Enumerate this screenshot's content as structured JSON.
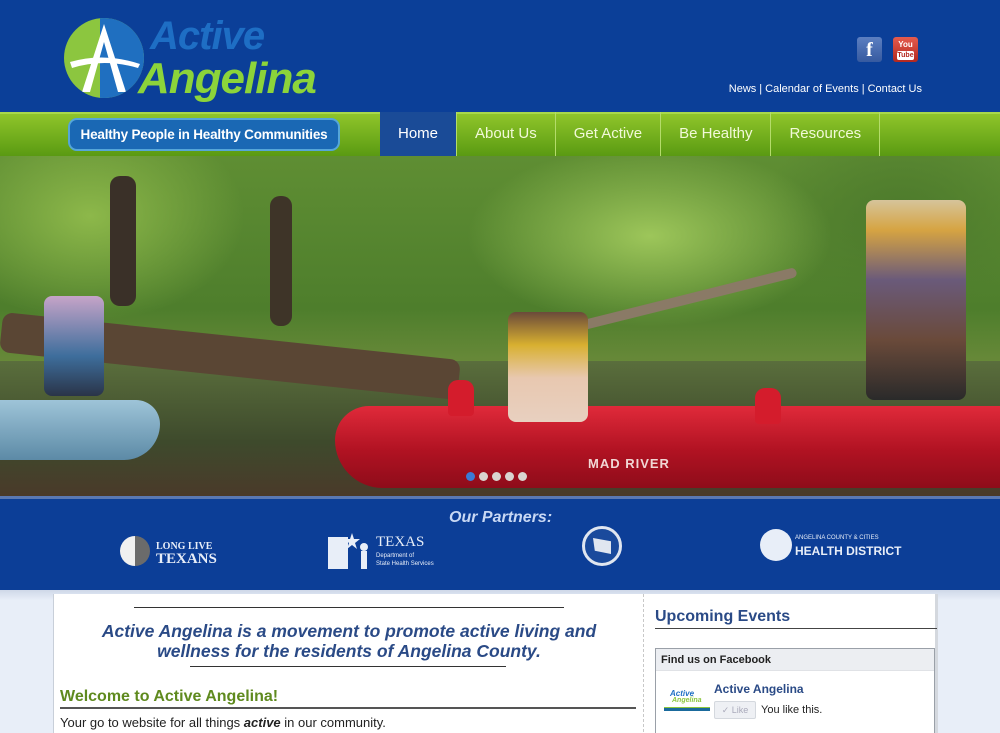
{
  "header": {
    "logo": {
      "line1": "Active",
      "line2": "Angelina"
    },
    "social": [
      {
        "name": "facebook",
        "glyph": "f"
      },
      {
        "name": "youtube",
        "glyph_top": "You",
        "glyph_bottom": "Tube"
      }
    ],
    "top_links": [
      "News",
      "Calendar of Events",
      "Contact Us"
    ],
    "separator": "|"
  },
  "nav": {
    "tagline": "Healthy People in Healthy Communities",
    "items": [
      {
        "label": "Home",
        "active": true
      },
      {
        "label": "About Us",
        "active": false
      },
      {
        "label": "Get Active",
        "active": false
      },
      {
        "label": "Be Healthy",
        "active": false
      },
      {
        "label": "Resources",
        "active": false
      }
    ]
  },
  "hero": {
    "kayak_brand": "MAD RIVER",
    "slides_total": 5,
    "active_slide": 1
  },
  "partners": {
    "title": "Our Partners:",
    "items": [
      {
        "line1": "LONG LIVE",
        "line2": "TEXANS"
      },
      {
        "line1": "TEXAS",
        "line2": "Department of",
        "line3": "State Health Services"
      },
      {
        "line1": ""
      },
      {
        "line1": "ANGELINA COUNTY & CITIES",
        "line2": "HEALTH DISTRICT"
      }
    ]
  },
  "main": {
    "mission": "Active Angelina is a movement to promote active living and wellness for the residents of Angelina County.",
    "welcome_heading": "Welcome to Active Angelina!",
    "body_before": "Your go to website for all things ",
    "body_emphasis": "active",
    "body_after": " in our community."
  },
  "sidebar": {
    "title": "Upcoming Events",
    "facebook_widget": {
      "header": "Find us on Facebook",
      "page_name": "Active Angelina",
      "like_label": "✓ Like",
      "status": "You like this.",
      "logo_line1": "Active",
      "logo_line2": "Angelina"
    }
  },
  "colors": {
    "header_blue": "#0b3f98",
    "nav_green": "#7ab51d",
    "nav_active": "#1a4b97",
    "brand_blue": "#1e6ec4",
    "brand_green": "#8cd43a",
    "heading_green": "#5f8a1e",
    "heading_blue": "#2a4a86"
  }
}
